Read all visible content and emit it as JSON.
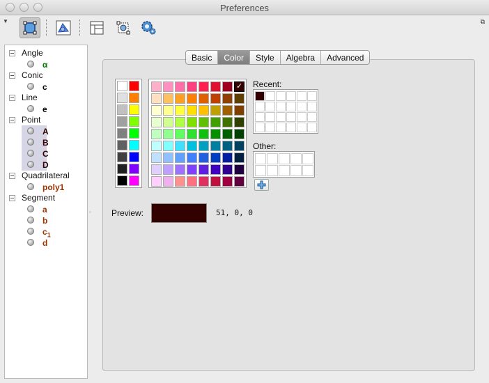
{
  "window": {
    "title": "Preferences",
    "controls": [
      {
        "name": "close",
        "color": "#cfcfcf"
      },
      {
        "name": "minimize",
        "color": "#cfcfcf"
      },
      {
        "name": "zoom",
        "color": "#cfcfcf"
      }
    ]
  },
  "toolbar": {
    "buttons": [
      {
        "name": "objects",
        "icon": "select-objects-icon",
        "selected": true
      },
      {
        "name": "graphics",
        "icon": "graphics-view-icon",
        "selected": false
      },
      {
        "name": "layout",
        "icon": "layout-icon",
        "selected": false
      },
      {
        "name": "defaults",
        "icon": "defaults-icon",
        "selected": false
      },
      {
        "name": "advanced",
        "icon": "gear-icon",
        "selected": false
      }
    ]
  },
  "tree": {
    "categories": [
      {
        "label": "Angle",
        "items": [
          {
            "label": "α",
            "color": "#007800",
            "selected": false
          }
        ]
      },
      {
        "label": "Conic",
        "items": [
          {
            "label": "c",
            "color": "#000000",
            "selected": false
          }
        ]
      },
      {
        "label": "Line",
        "items": [
          {
            "label": "e",
            "color": "#000000",
            "selected": false
          }
        ]
      },
      {
        "label": "Point",
        "items": [
          {
            "label": "A",
            "color": "#330000",
            "selected": true
          },
          {
            "label": "B",
            "color": "#330000",
            "selected": true
          },
          {
            "label": "C",
            "color": "#330000",
            "selected": true
          },
          {
            "label": "D",
            "color": "#330000",
            "selected": true
          }
        ]
      },
      {
        "label": "Quadrilateral",
        "items": [
          {
            "label": "poly1",
            "color": "#993300",
            "selected": false
          }
        ]
      },
      {
        "label": "Segment",
        "items": [
          {
            "label": "a",
            "color": "#993300",
            "selected": false
          },
          {
            "label": "b",
            "color": "#993300",
            "selected": false
          },
          {
            "label": "c",
            "sub": "1",
            "color": "#993300",
            "selected": false
          },
          {
            "label": "d",
            "color": "#993300",
            "selected": false
          }
        ]
      }
    ]
  },
  "tabs": [
    {
      "label": "Basic",
      "active": false
    },
    {
      "label": "Color",
      "active": true
    },
    {
      "label": "Style",
      "active": false
    },
    {
      "label": "Algebra",
      "active": false
    },
    {
      "label": "Advanced",
      "active": false
    }
  ],
  "color_tab": {
    "recent_label": "Recent:",
    "other_label": "Other:",
    "preview_label": "Preview:",
    "preview_value": "51, 0, 0",
    "preview_color": "#330000",
    "recent_colors": [
      "#330000"
    ],
    "gray_palette": [
      [
        "#ffffff",
        "#ff0000"
      ],
      [
        "#e0e0e0",
        "#ff8000"
      ],
      [
        "#c0c0c0",
        "#ffff00"
      ],
      [
        "#a0a0a0",
        "#80ff00"
      ],
      [
        "#808080",
        "#00ff00"
      ],
      [
        "#606060",
        "#00ffff"
      ],
      [
        "#404040",
        "#0000ff"
      ],
      [
        "#202020",
        "#8000ff"
      ],
      [
        "#000000",
        "#ff00ff"
      ]
    ],
    "main_palette": [
      [
        "#ffb0c8",
        "#ff90c0",
        "#ff70a8",
        "#ff4080",
        "#ff2050",
        "#e01030",
        "#a00020",
        "#330000"
      ],
      [
        "#ffe0c0",
        "#ffc060",
        "#ffa020",
        "#ff8000",
        "#e06000",
        "#c04000",
        "#904000",
        "#604000"
      ],
      [
        "#ffffd0",
        "#ffff90",
        "#ffff40",
        "#ffe000",
        "#ffc000",
        "#c0a000",
        "#a06000",
        "#804000"
      ],
      [
        "#e8ffd0",
        "#d0ff90",
        "#b0ff40",
        "#80e000",
        "#60c000",
        "#40a000",
        "#407000",
        "#304000"
      ],
      [
        "#c0ffc0",
        "#90ff90",
        "#60ff60",
        "#30e030",
        "#10c010",
        "#009000",
        "#006000",
        "#004000"
      ],
      [
        "#c0ffff",
        "#80ffff",
        "#40e0ff",
        "#00c0e0",
        "#00a0c0",
        "#0080a0",
        "#006080",
        "#004060"
      ],
      [
        "#c0e0ff",
        "#90c0ff",
        "#60a0ff",
        "#4080ff",
        "#2060e0",
        "#0040c0",
        "#0020a0",
        "#002040"
      ],
      [
        "#e0d0ff",
        "#c0a0ff",
        "#a070ff",
        "#8040ff",
        "#6020e0",
        "#4000c0",
        "#300090",
        "#200040"
      ],
      [
        "#ffd0ff",
        "#f0b0f0",
        "#ff9090",
        "#ff7080",
        "#e03060",
        "#c01040",
        "#a00040",
        "#600040"
      ]
    ],
    "selected_index": [
      0,
      7
    ]
  }
}
